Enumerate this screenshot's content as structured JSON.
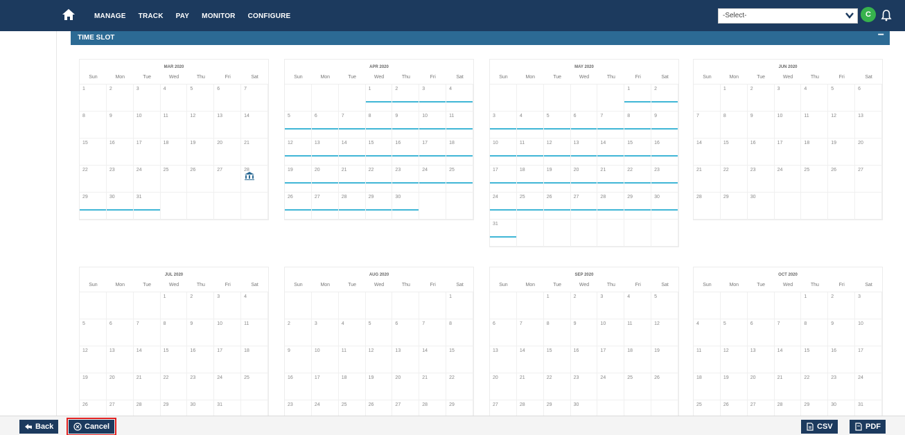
{
  "nav": {
    "items": [
      "MANAGE",
      "TRACK",
      "PAY",
      "MONITOR",
      "CONFIGURE"
    ]
  },
  "select": {
    "value": "-Select-"
  },
  "user": {
    "initial": "C"
  },
  "section": {
    "title": "TIME SLOT",
    "toggle": "−"
  },
  "weekdays": [
    "Sun",
    "Mon",
    "Tue",
    "Wed",
    "Thu",
    "Fri",
    "Sat"
  ],
  "calendars": [
    {
      "title": "MAR 2020",
      "start": 0,
      "days": 31,
      "highlight": [
        29,
        30,
        31
      ],
      "pin": 28
    },
    {
      "title": "APR 2020",
      "start": 3,
      "days": 30,
      "highlight": [
        1,
        2,
        3,
        4,
        5,
        6,
        7,
        8,
        9,
        10,
        11,
        12,
        13,
        14,
        15,
        16,
        17,
        18,
        19,
        20,
        21,
        22,
        23,
        24,
        25,
        26,
        27,
        28,
        29,
        30
      ]
    },
    {
      "title": "MAY 2020",
      "start": 5,
      "days": 31,
      "highlight": [
        1,
        2,
        3,
        4,
        5,
        6,
        7,
        8,
        9,
        10,
        11,
        12,
        13,
        14,
        15,
        16,
        17,
        18,
        19,
        20,
        21,
        22,
        23,
        24,
        25,
        26,
        27,
        28,
        29,
        30,
        31
      ]
    },
    {
      "title": "JUN 2020",
      "start": 1,
      "days": 30,
      "highlight": []
    },
    {
      "title": "JUL 2020",
      "start": 3,
      "days": 31,
      "highlight": []
    },
    {
      "title": "AUG 2020",
      "start": 6,
      "days": 31,
      "highlight": []
    },
    {
      "title": "SEP 2020",
      "start": 2,
      "days": 30,
      "highlight": []
    },
    {
      "title": "OCT 2020",
      "start": 4,
      "days": 31,
      "highlight": []
    }
  ],
  "footer": {
    "back": "Back",
    "cancel": "Cancel",
    "csv": "CSV",
    "pdf": "PDF"
  },
  "colors": {
    "navbar": "#1c3a5e",
    "section": "#2c6a94",
    "highlight": "#3fb6d6",
    "avatar": "#37b24d"
  }
}
